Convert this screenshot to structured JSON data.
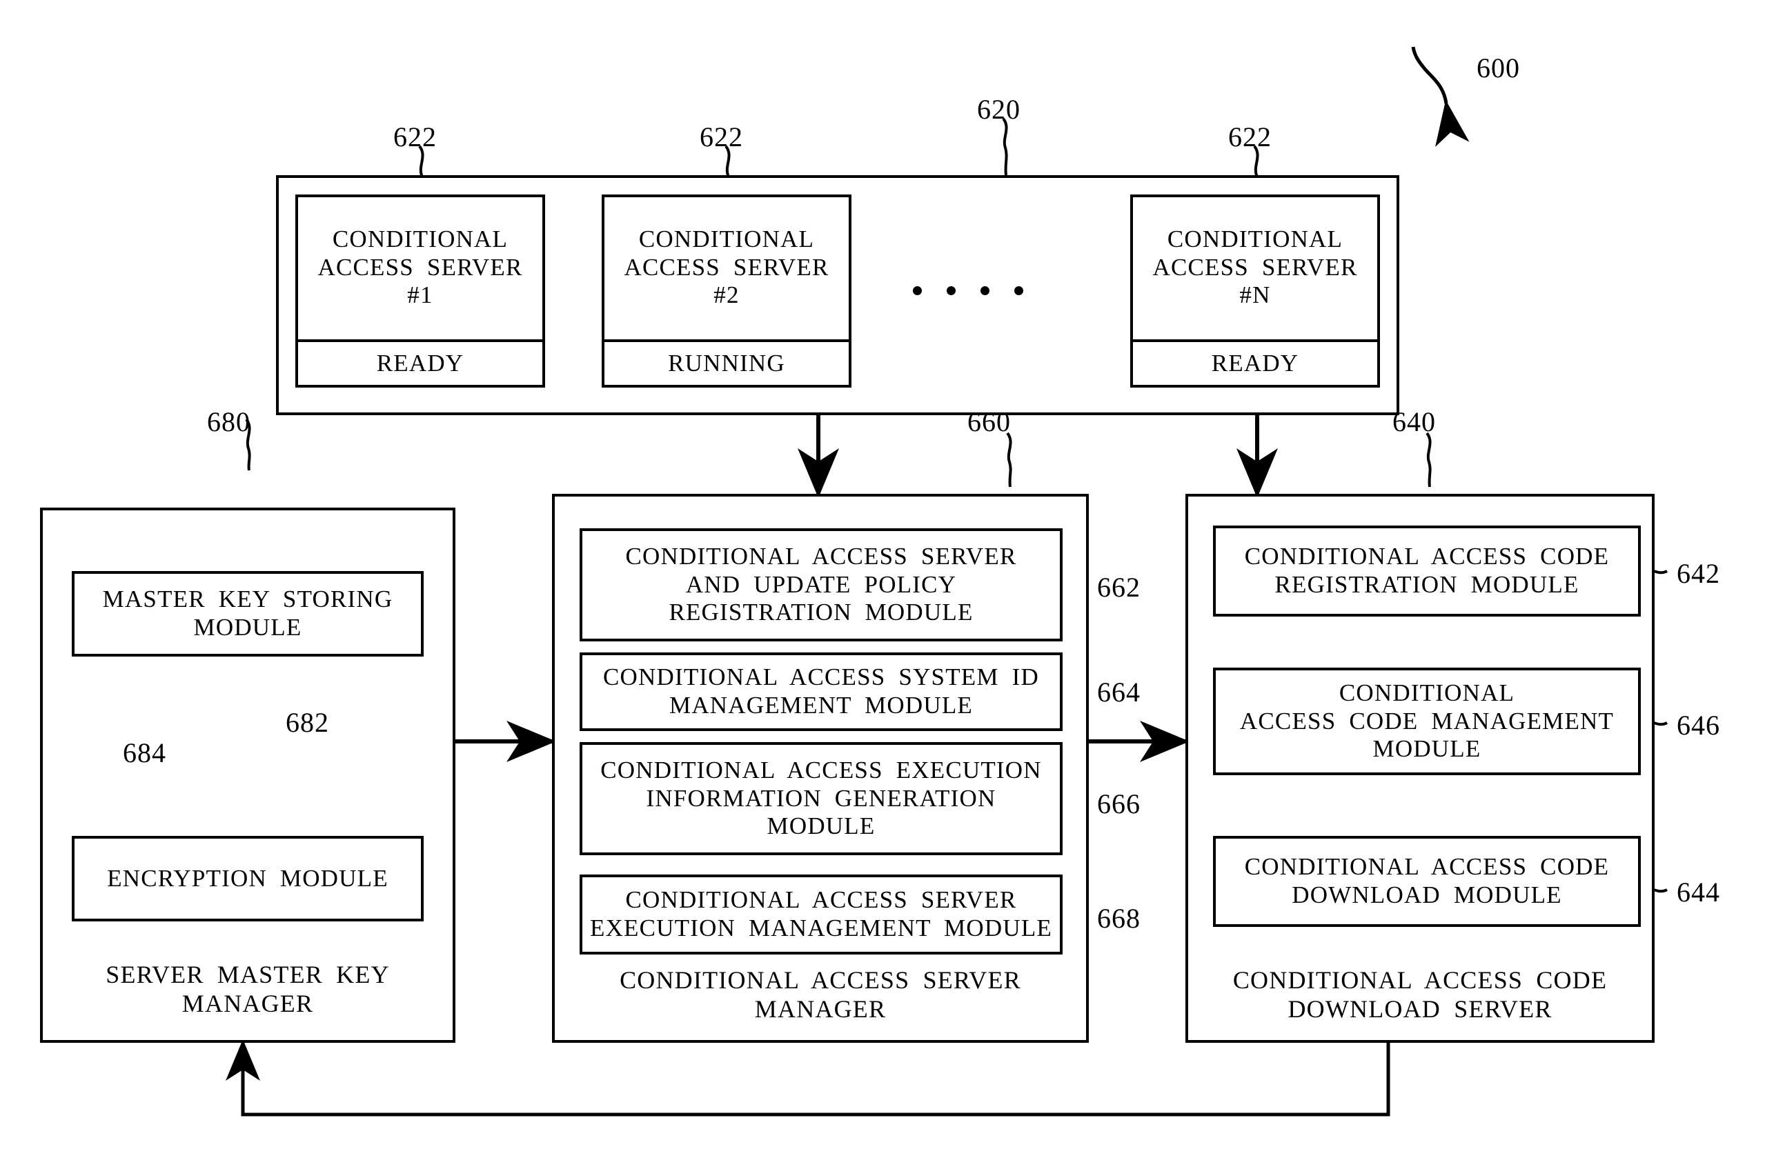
{
  "figure": {
    "number": "600",
    "title_ref": "600"
  },
  "ref_numbers": {
    "system": "600",
    "server_group": "620",
    "server_item": "622",
    "server_item_2": "622",
    "server_item_n": "622",
    "key_manager": "680",
    "master_key_storing": "682",
    "encryption": "684",
    "ca_server_manager": "660",
    "policy_registration": "662",
    "system_id_management": "664",
    "execution_info_generation": "666",
    "server_execution_management": "668",
    "code_download_server": "640",
    "code_registration": "642",
    "code_management": "646",
    "code_download": "644"
  },
  "server_group": {
    "servers": [
      {
        "title": "CONDITIONAL\nACCESS SERVER\n#1",
        "status": "READY"
      },
      {
        "title": "CONDITIONAL\nACCESS SERVER\n#2",
        "status": "RUNNING"
      },
      {
        "title": "CONDITIONAL\nACCESS SERVER\n#N",
        "status": "READY"
      }
    ],
    "ellipsis_dots": 4
  },
  "key_manager": {
    "label": "SERVER MASTER KEY\nMANAGER",
    "modules": [
      {
        "label": "MASTER KEY STORING\nMODULE"
      },
      {
        "label": "ENCRYPTION MODULE"
      }
    ]
  },
  "ca_server_manager": {
    "label": "CONDITIONAL ACCESS SERVER\nMANAGER",
    "modules": [
      {
        "label": "CONDITIONAL ACCESS SERVER\nAND UPDATE POLICY\nREGISTRATION MODULE"
      },
      {
        "label": "CONDITIONAL ACCESS SYSTEM ID\nMANAGEMENT MODULE"
      },
      {
        "label": "CONDITIONAL ACCESS EXECUTION\nINFORMATION GENERATION\nMODULE"
      },
      {
        "label": "CONDITIONAL ACCESS SERVER\nEXECUTION MANAGEMENT MODULE"
      }
    ]
  },
  "code_download_server": {
    "label": "CONDITIONAL ACCESS CODE\nDOWNLOAD SERVER",
    "modules": [
      {
        "label": "CONDITIONAL ACCESS CODE\nREGISTRATION MODULE"
      },
      {
        "label": "CONDITIONAL\nACCESS CODE MANAGEMENT\nMODULE"
      },
      {
        "label": "CONDITIONAL ACCESS CODE\nDOWNLOAD MODULE"
      }
    ]
  },
  "colors": {
    "ink": "#000000",
    "paper": "#ffffff"
  }
}
